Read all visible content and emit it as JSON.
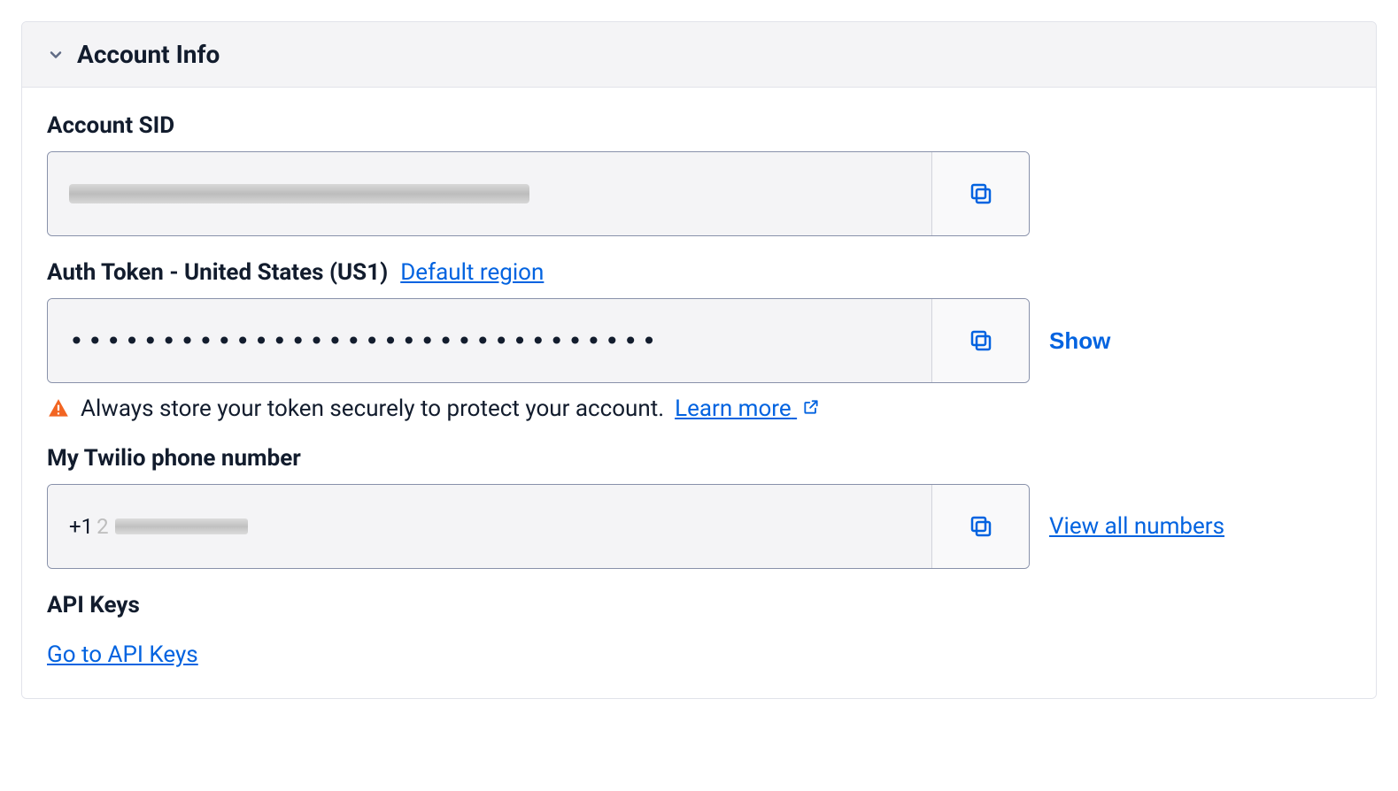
{
  "panel": {
    "title": "Account Info"
  },
  "accountSid": {
    "label": "Account SID",
    "value": "",
    "redacted": true
  },
  "authToken": {
    "label_prefix": "Auth Token - United States (US1)",
    "region_link": "Default region",
    "masked_value": "••••••••••••••••••••••••••••••••",
    "show_label": "Show",
    "hint_text": "Always store your token securely to protect your account.",
    "learn_more": "Learn more"
  },
  "phone": {
    "label": "My Twilio phone number",
    "prefix": "+1",
    "rest_redacted": "2",
    "view_all": "View all numbers"
  },
  "apiKeys": {
    "label": "API Keys",
    "link": "Go to API Keys"
  }
}
